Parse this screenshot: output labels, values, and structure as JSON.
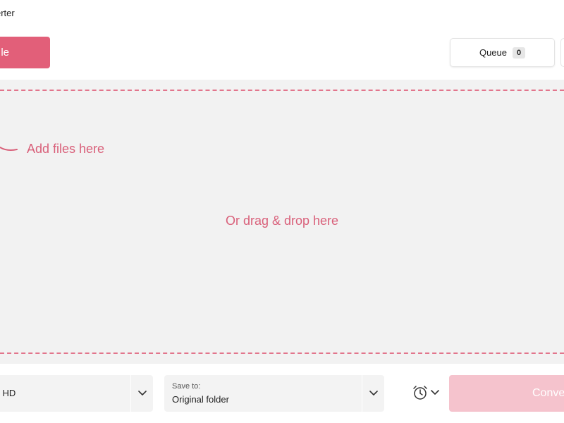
{
  "app": {
    "title": "erter"
  },
  "toolbar": {
    "add_file_label": "le",
    "queue_label": "Queue",
    "queue_count": "0"
  },
  "drop_zone": {
    "add_files_hint": "Add files here",
    "drag_drop_hint": "Or drag & drop here"
  },
  "bottom_bar": {
    "format_value": "l HD",
    "save_to_label": "Save to:",
    "save_to_value": "Original folder",
    "convert_label": "Conve"
  },
  "colors": {
    "accent": "#e25f79",
    "accent_disabled": "#f5c3cd",
    "hint_text": "#d9607a",
    "drop_zone_bg": "#f2f2f2"
  },
  "icons": {
    "hint_arrow": "curved-arrow-icon",
    "dropdown": "chevron-down-icon",
    "schedule": "alarm-clock-icon"
  }
}
